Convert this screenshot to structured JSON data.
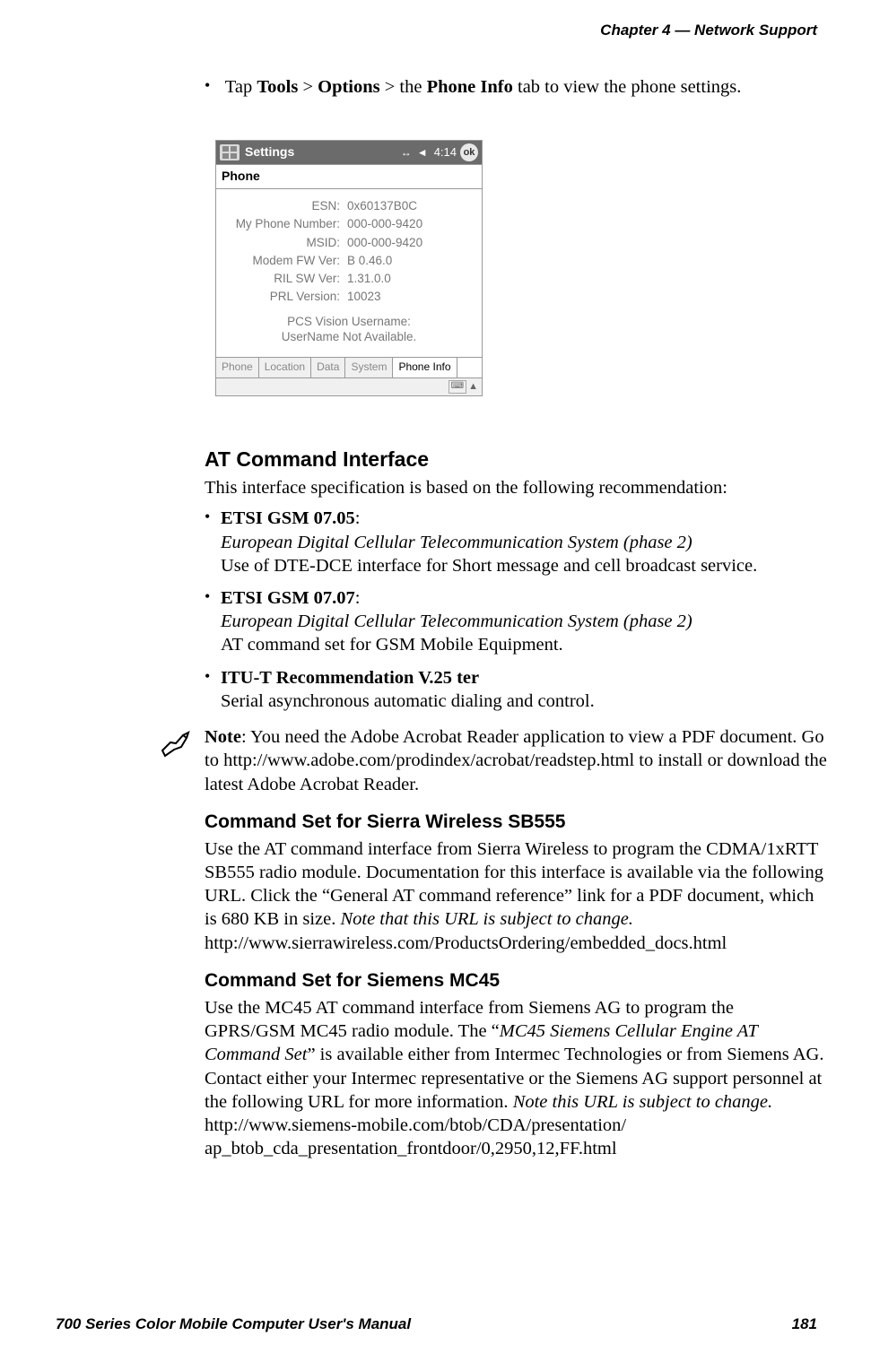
{
  "header": {
    "chapter": "Chapter  4",
    "sep": "  —  ",
    "title": "Network Support"
  },
  "intro_bullet": {
    "pre": "Tap ",
    "b1": "Tools",
    "mid1": " > ",
    "b2": "Options",
    "mid2": " > the ",
    "b3": "Phone Info",
    "post": " tab to view the phone settings."
  },
  "screenshot": {
    "titlebar": {
      "title": "Settings",
      "time": "4:14",
      "ok": "ok"
    },
    "subtitle": "Phone",
    "rows": [
      {
        "label": "ESN:",
        "value": "0x60137B0C"
      },
      {
        "label": "My Phone Number:",
        "value": "000-000-9420"
      },
      {
        "label": "MSID:",
        "value": "000-000-9420"
      },
      {
        "label": "Modem FW Ver:",
        "value": "B 0.46.0"
      },
      {
        "label": "RIL SW Ver:",
        "value": "1.31.0.0"
      },
      {
        "label": "PRL Version:",
        "value": "10023"
      }
    ],
    "pcs_title": "PCS Vision Username:",
    "pcs_value": "UserName Not Available.",
    "tabs": [
      "Phone",
      "Location",
      "Data",
      "System",
      "Phone Info"
    ],
    "active_tab_index": 4
  },
  "at_section": {
    "heading": "AT Command Interface",
    "intro": "This interface specification is based on the following recommendation:",
    "items": [
      {
        "title": "ETSI GSM 07.05",
        "colon": ":",
        "italic": "European Digital Cellular Telecommunication System (phase 2)",
        "desc": "Use of DTE-DCE interface for Short message and cell broadcast service."
      },
      {
        "title": "ETSI GSM 07.07",
        "colon": ":",
        "italic": "European Digital Cellular Telecommunication System (phase 2)",
        "desc": "AT command set for GSM Mobile Equipment."
      },
      {
        "title": "ITU-T Recommendation V.25 ter",
        "colon": "",
        "italic": "",
        "desc": "Serial asynchronous automatic dialing and control."
      }
    ]
  },
  "note": {
    "label": "Note",
    "text": ": You need the Adobe Acrobat Reader application to view a PDF document. Go to http://www.adobe.com/prodindex/acrobat/readstep.html to install or download the latest Adobe Acrobat Reader."
  },
  "sb555": {
    "heading": "Command Set for Sierra Wireless SB555",
    "body_pre": "Use the AT command interface from Sierra Wireless to program the CDMA/1xRTT SB555 radio module. Documentation for this interface is available via the following URL. Click the “General AT command reference” link for a PDF document, which is 680 KB in size. ",
    "body_italic": "Note that this URL is subject to change.",
    "url": "http://www.sierrawireless.com/ProductsOrdering/embedded_docs.html"
  },
  "mc45": {
    "heading": "Command Set for Siemens MC45",
    "body_pre": "Use the MC45 AT command interface from Siemens AG to program the GPRS/GSM MC45 radio module. The “",
    "body_italic1": "MC45 Siemens Cellular Engine AT Command Set",
    "body_mid": "” is available either from Intermec Technologies or from Siemens AG. Contact either your Intermec representative or the Siemens AG support personnel at the following URL for more information. ",
    "body_italic2": "Note this URL is subject to change.",
    "url1": "http://www.siemens-mobile.com/btob/CDA/presentation/",
    "url2": "ap_btob_cda_presentation_frontdoor/0,2950,12,FF.html"
  },
  "footer": {
    "left": "700 Series Color Mobile Computer User's Manual",
    "right": "181"
  }
}
